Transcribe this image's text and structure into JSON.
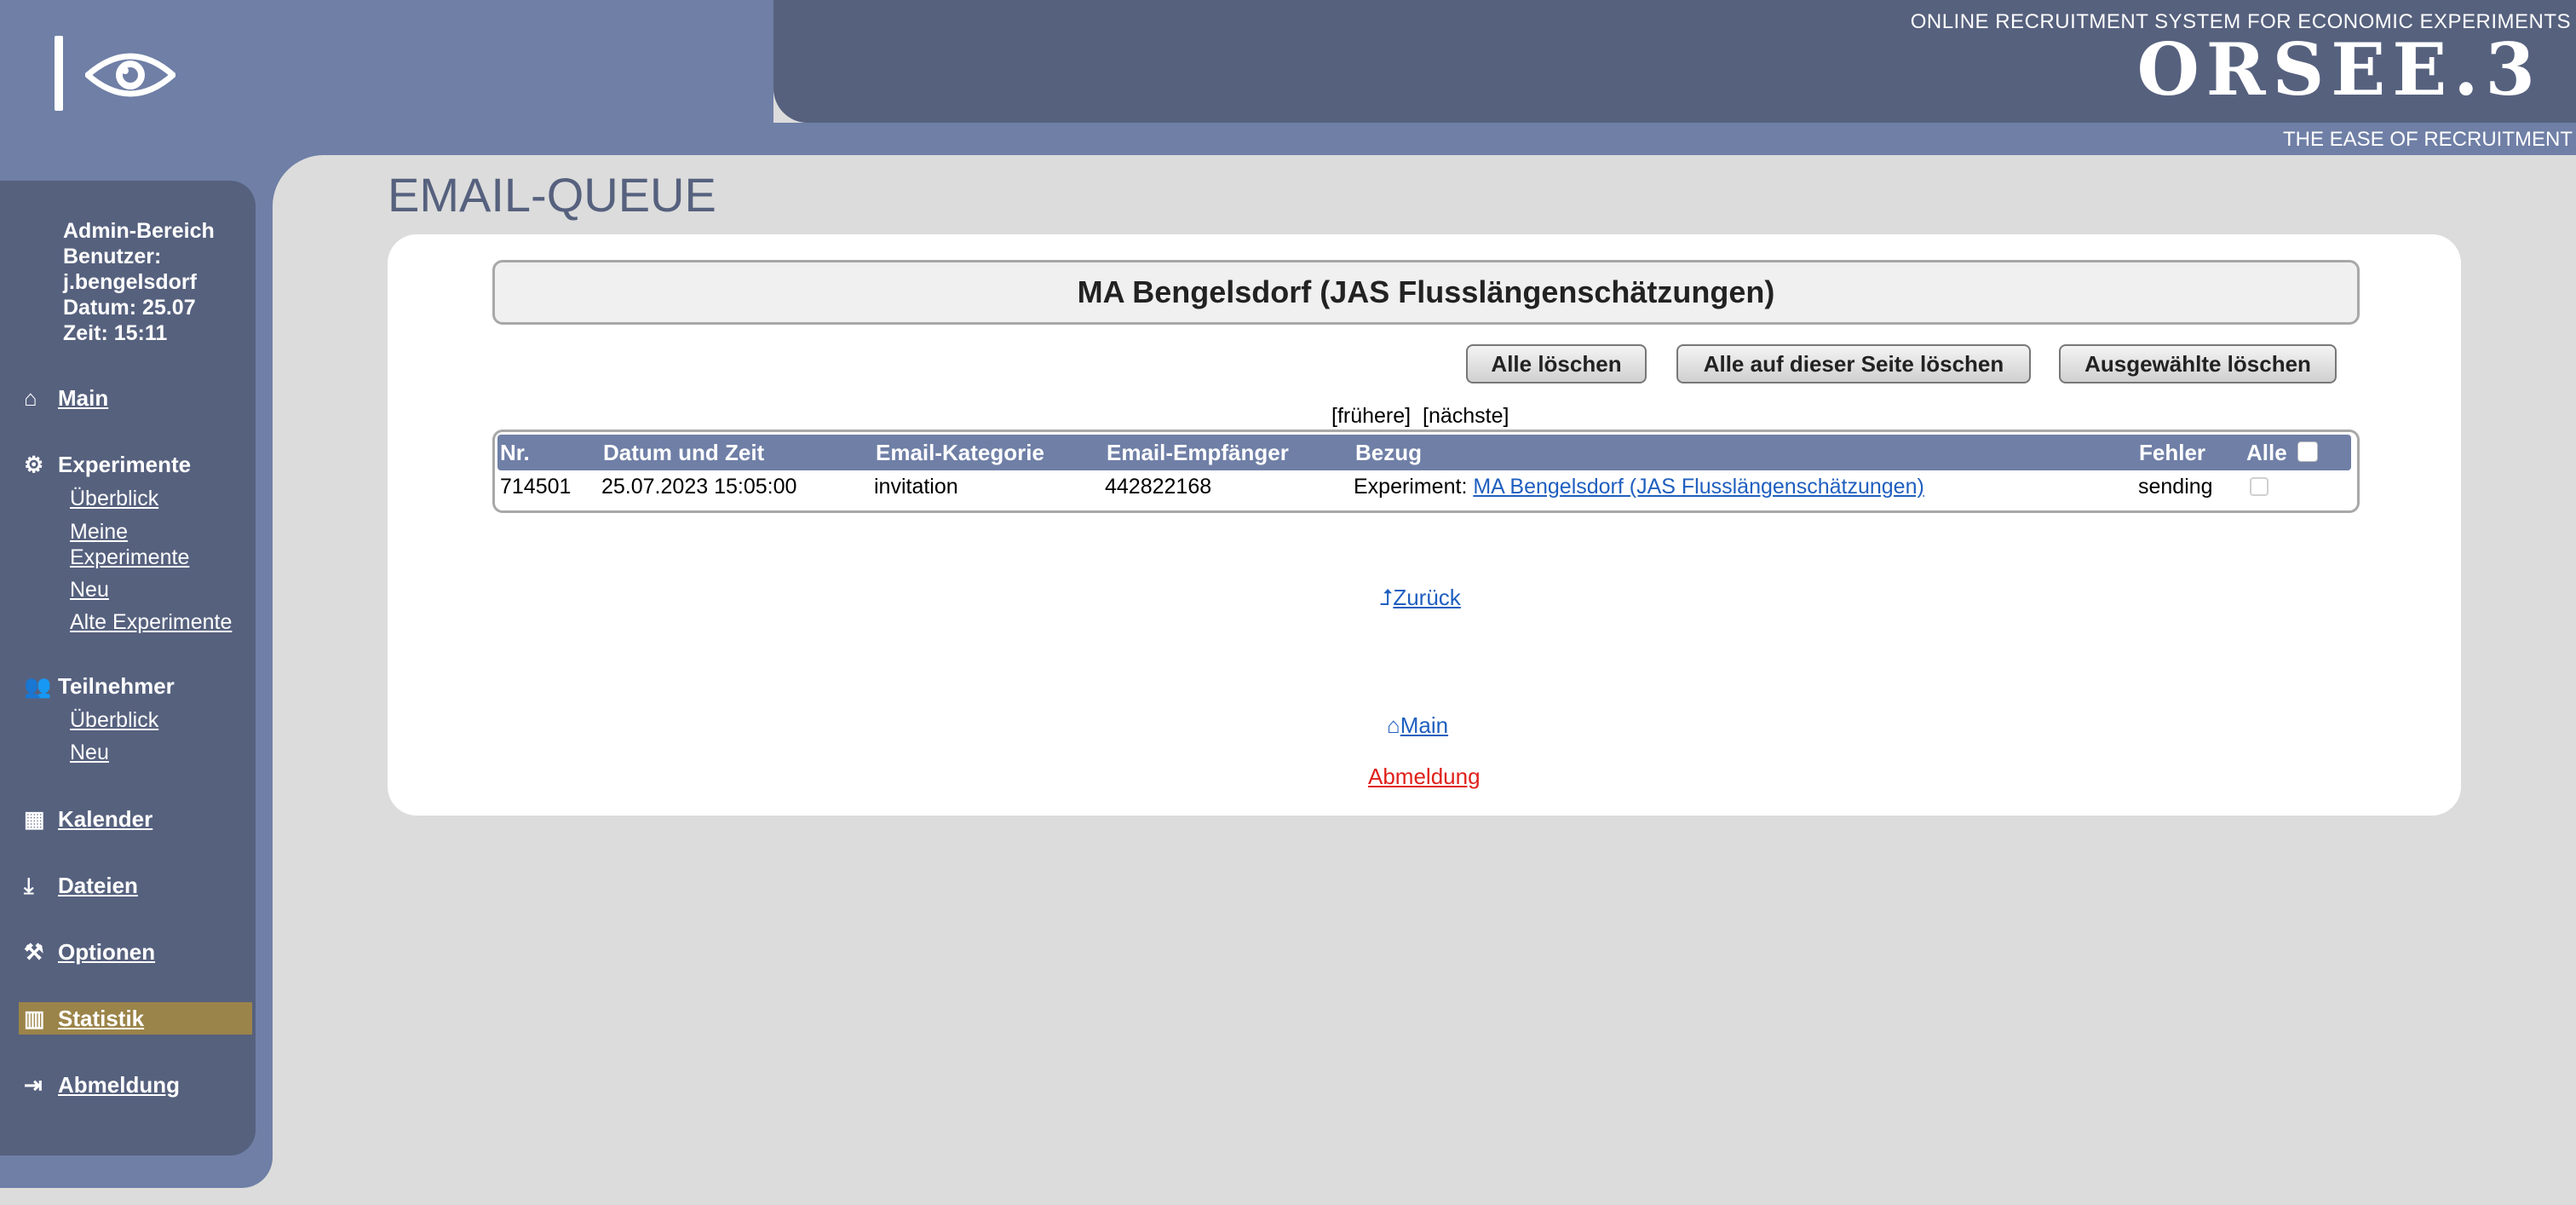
{
  "header": {
    "tagline_top": "ONLINE RECRUITMENT SYSTEM FOR ECONOMIC EXPERIMENTS",
    "brand": "ORSEE.3",
    "tagline_bottom": "THE EASE OF RECRUITMENT",
    "logo_icon": "eye-icon"
  },
  "sidebar": {
    "info": {
      "area": "Admin-Bereich",
      "user_label": "Benutzer:",
      "user": "j.bengelsdorf",
      "date": "Datum: 25.07",
      "time": "Zeit: 15:11"
    },
    "items": [
      {
        "label": "Main",
        "icon": "home-icon"
      },
      {
        "label": "Experimente",
        "icon": "gears-icon",
        "sub": [
          "Überblick",
          "Meine",
          "Experimente",
          "Neu",
          "Alte Experimente"
        ]
      },
      {
        "label": "Teilnehmer",
        "icon": "users-icon",
        "sub": [
          "Überblick",
          "Neu"
        ]
      },
      {
        "label": "Kalender",
        "icon": "calendar-icon"
      },
      {
        "label": "Dateien",
        "icon": "download-icon"
      },
      {
        "label": "Optionen",
        "icon": "gavel-icon"
      },
      {
        "label": "Statistik",
        "icon": "bar-chart-icon",
        "active": true
      },
      {
        "label": "Abmeldung",
        "icon": "sign-out-icon"
      }
    ],
    "active_color": "#9b8449"
  },
  "main": {
    "page_title": "EMAIL-QUEUE",
    "experiment_title": "MA Bengelsdorf (JAS Flusslängenschätzungen)",
    "buttons": {
      "delete_all": "Alle löschen",
      "delete_page": "Alle auf dieser Seite löschen",
      "delete_selected": "Ausgewählte löschen"
    },
    "pager": {
      "prev": "[frühere]",
      "next": "[nächste]"
    },
    "table": {
      "headers": [
        "Nr.",
        "Datum und Zeit",
        "Email-Kategorie",
        "Email-Empfänger",
        "Bezug",
        "Fehler",
        "Alle"
      ],
      "rows": [
        {
          "nr": "714501",
          "datetime": "25.07.2023 15:05:00",
          "category": "invitation",
          "recipient": "442822168",
          "ref_prefix": "Experiment:",
          "ref_link": "MA Bengelsdorf (JAS Flusslängenschätzungen)",
          "error": "sending",
          "selected": false
        }
      ]
    },
    "back_link": "Zurück",
    "main_link": "Main",
    "logout_link": "Abmeldung"
  },
  "colors": {
    "header_light": "#6f7fa6",
    "header_dark": "#56617e",
    "link": "#1f5fbf",
    "logout": "#e0201a",
    "background": "#dcdcdc"
  }
}
